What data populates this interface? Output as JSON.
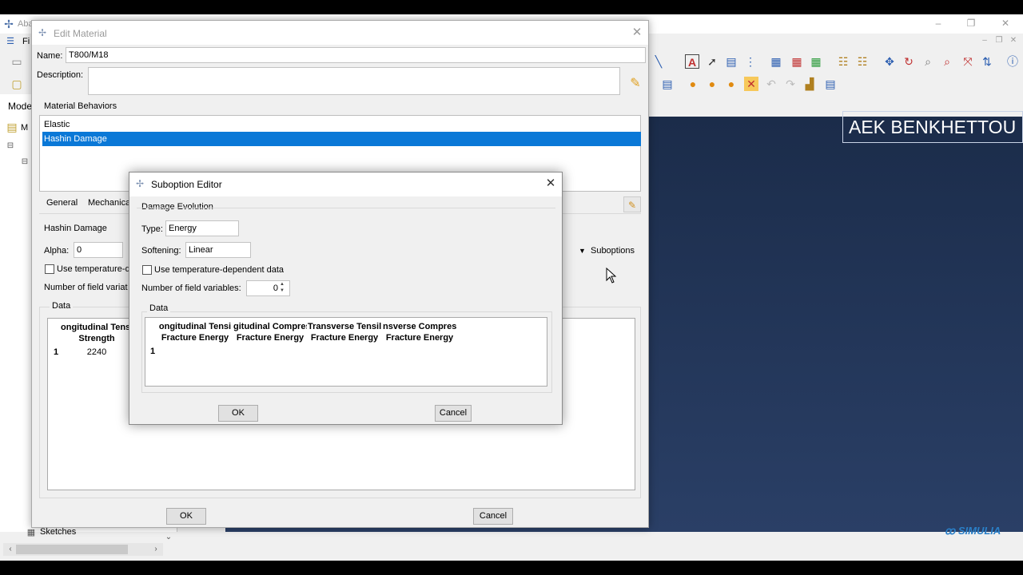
{
  "app": {
    "title": "Aba",
    "menu_first": "Fi",
    "tree_tab": "Mode",
    "tree_model": "M",
    "sketches_label": "Sketches",
    "watermark_text": "AEK BENKHETTOU",
    "brand_logo": "SIMULIA"
  },
  "edit_material": {
    "title": "Edit Material",
    "name_label": "Name:",
    "name_value": "T800/M18",
    "description_label": "Description:",
    "description_value": "",
    "behaviors_label": "Material Behaviors",
    "behaviors": [
      "Elastic",
      "Hashin Damage"
    ],
    "selected_behavior": "Hashin Damage",
    "tabs": [
      "General",
      "Mechanica"
    ],
    "section_title": "Hashin Damage",
    "alpha_label": "Alpha:",
    "alpha_value": "0",
    "temp_dep_label": "Use temperature-d",
    "field_vars_label": "Number of field variat",
    "data_label": "Data",
    "table": {
      "header_line1": "ongitudinal Tensi",
      "header_line2": "Strength",
      "row_index": "1",
      "row_value": "2240"
    },
    "suboptions_label": "Suboptions",
    "ok_label": "OK",
    "cancel_label": "Cancel"
  },
  "suboption_editor": {
    "title": "Suboption Editor",
    "section": "Damage Evolution",
    "type_label": "Type:",
    "type_value": "Energy",
    "softening_label": "Softening:",
    "softening_value": "Linear",
    "temp_dep_label": "Use temperature-dependent data",
    "field_vars_label": "Number of field variables:",
    "field_vars_value": "0",
    "data_label": "Data",
    "columns": [
      {
        "line1": "ongitudinal Tensi",
        "line2": "Fracture Energy"
      },
      {
        "line1": "gitudinal Compres",
        "line2": "Fracture Energy"
      },
      {
        "line1": "Transverse Tensile",
        "line2": "Fracture Energy"
      },
      {
        "line1": "nsverse Compress",
        "line2": "Fracture Energy"
      }
    ],
    "row_index": "1",
    "ok_label": "OK",
    "cancel_label": "Cancel"
  },
  "colors": {
    "selection": "#0a78d7",
    "viewport_top": "#1b2c4a",
    "viewport_bottom": "#2a3f66",
    "brand": "#2a7fc7"
  }
}
